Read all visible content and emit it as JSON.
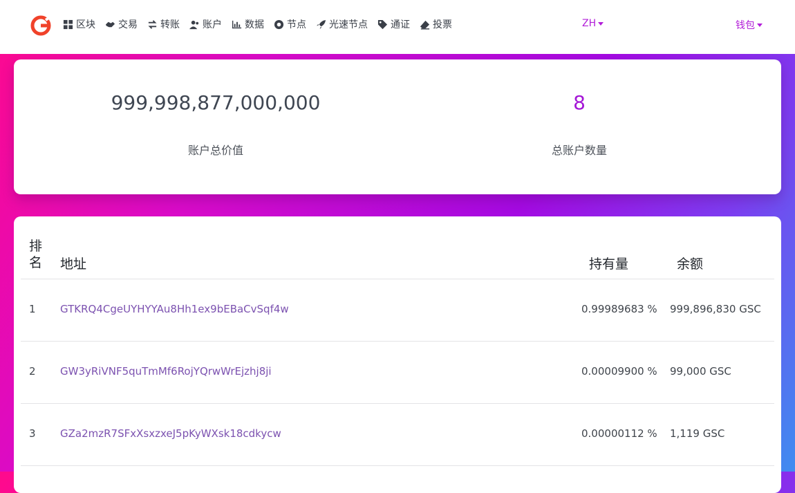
{
  "nav": {
    "items": [
      {
        "label": "区块",
        "icon": "grid-icon"
      },
      {
        "label": "交易",
        "icon": "handshake-icon"
      },
      {
        "label": "转账",
        "icon": "exchange-arrows-icon"
      },
      {
        "label": "账户",
        "icon": "users-icon"
      },
      {
        "label": "数据",
        "icon": "bar-chart-icon"
      },
      {
        "label": "节点",
        "icon": "dot-circle-icon"
      },
      {
        "label": "光速节点",
        "icon": "rocket-icon"
      },
      {
        "label": "通证",
        "icon": "tag-icon"
      },
      {
        "label": "投票",
        "icon": "eraser-icon"
      }
    ],
    "lang": "ZH",
    "wallet": "钱包"
  },
  "stats": {
    "total_value": "999,998,877,000,000",
    "total_value_label": "账户总价值",
    "account_count": "8",
    "account_count_label": "总账户数量"
  },
  "table": {
    "headers": {
      "rank": "排名",
      "address": "地址",
      "share": "持有量",
      "balance": "余额"
    },
    "rows": [
      {
        "rank": "1",
        "address": "GTKRQ4CgeUYHYYAu8Hh1ex9bEBaCvSqf4w",
        "share": "0.99989683 %",
        "balance": "999,896,830 GSC"
      },
      {
        "rank": "2",
        "address": "GW3yRiVNF5quTmMf6RojYQrwWrEjzhj8ji",
        "share": "0.00009900 %",
        "balance": "99,000 GSC"
      },
      {
        "rank": "3",
        "address": "GZa2mzR7SFxXsxzxeJ5pKyWXsk18cdkycw",
        "share": "0.00000112 %",
        "balance": "1,119 GSC"
      }
    ]
  },
  "colors": {
    "accent": "#b21ed8",
    "link": "#7c52b0"
  }
}
